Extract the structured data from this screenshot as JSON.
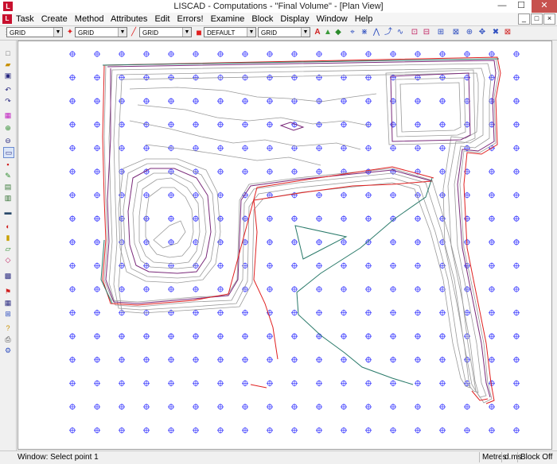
{
  "window": {
    "title": "LISCAD - Computations - \"Final Volume\" - [Plan View]",
    "app_icon": "L",
    "minimize_label": "—",
    "maximize_label": "☐",
    "close_label": "✕"
  },
  "menu": {
    "items": [
      "Task",
      "Create",
      "Method",
      "Attributes",
      "Edit",
      "Errors!",
      "Examine",
      "Block",
      "Display",
      "Window",
      "Help"
    ],
    "mdi_buttons": [
      "_",
      "□",
      "×"
    ]
  },
  "toolbar": {
    "layer_combo": "GRID",
    "point_combo": "GRID",
    "line_combo": "GRID",
    "linetype_combo": "DEFAULT",
    "text_combo": "GRID"
  },
  "status": {
    "message": "Window: Select point 1",
    "units": "Metres",
    "angle_format": "d.ms",
    "block_state": "Block Off"
  },
  "colors": {
    "grid_point": "#3b3bff",
    "contour_gray": "#9a9a9a",
    "contour_purple": "#7a2a7a",
    "contour_red": "#e02020",
    "contour_teal": "#2a7a6a"
  }
}
